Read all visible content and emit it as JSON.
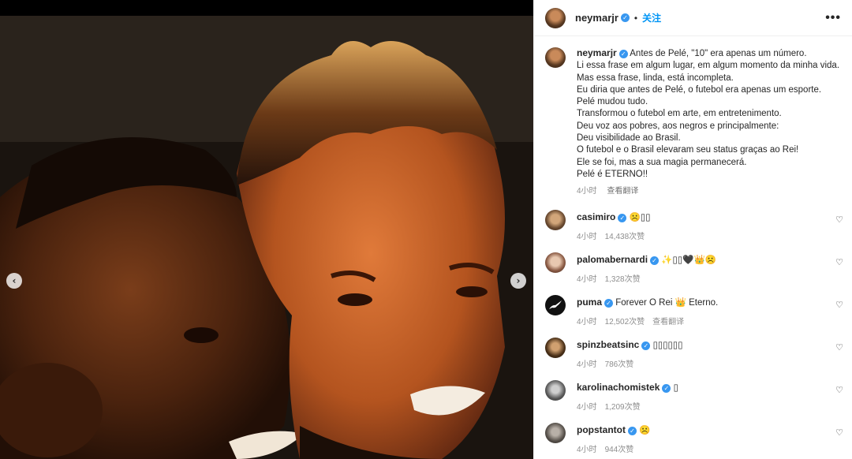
{
  "post": {
    "username": "neymarjr",
    "follow_label": "关注",
    "dot": "•",
    "more_label": "•••"
  },
  "caption": {
    "username": "neymarjr",
    "lines": [
      "Antes de Pelé, \"10\" era apenas um número.",
      "Li essa frase em algum lugar, em algum momento da minha vida.",
      "Mas essa frase, linda, está incompleta.",
      "Eu diria que antes de Pelé, o futebol era apenas um esporte.",
      "Pelé mudou tudo.",
      "Transformou o futebol em arte, em entretenimento.",
      "Deu voz aos pobres, aos negros e principalmente:",
      "Deu visibilidade ao Brasil.",
      "O futebol e o Brasil elevaram seu status graças ao Rei!",
      "Ele se foi, mas a sua magia permanecerá.",
      "Pelé é ETERNO!!"
    ],
    "time": "4小时",
    "translate": "查看翻译"
  },
  "comments": [
    {
      "username": "casimiro",
      "text": "☹️▯▯",
      "time": "4小时",
      "likes": "14,438次赞",
      "translate": "",
      "verified": true
    },
    {
      "username": "palomabernardi",
      "text": "✨▯▯🖤👑☹️",
      "time": "4小时",
      "likes": "1,328次赞",
      "translate": "",
      "verified": true
    },
    {
      "username": "puma",
      "text": "Forever O Rei 👑 Eterno.",
      "time": "4小时",
      "likes": "12,502次赞",
      "translate": "查看翻译",
      "verified": true
    },
    {
      "username": "spinzbeatsinc",
      "text": "▯▯▯▯▯▯",
      "time": "4小时",
      "likes": "786次赞",
      "translate": "",
      "verified": true
    },
    {
      "username": "karolinachomistek",
      "text": "▯",
      "time": "4小时",
      "likes": "1,209次赞",
      "translate": "",
      "verified": true
    },
    {
      "username": "popstantot",
      "text": "☹️",
      "time": "4小时",
      "likes": "944次赞",
      "translate": "",
      "verified": true
    }
  ],
  "icons": {
    "verified": "✓",
    "heart": "♡",
    "prev": "‹",
    "next": "›"
  },
  "colors": {
    "follow": "#0095f6",
    "verified": "#3897f0",
    "meta": "#8e8e8e"
  }
}
